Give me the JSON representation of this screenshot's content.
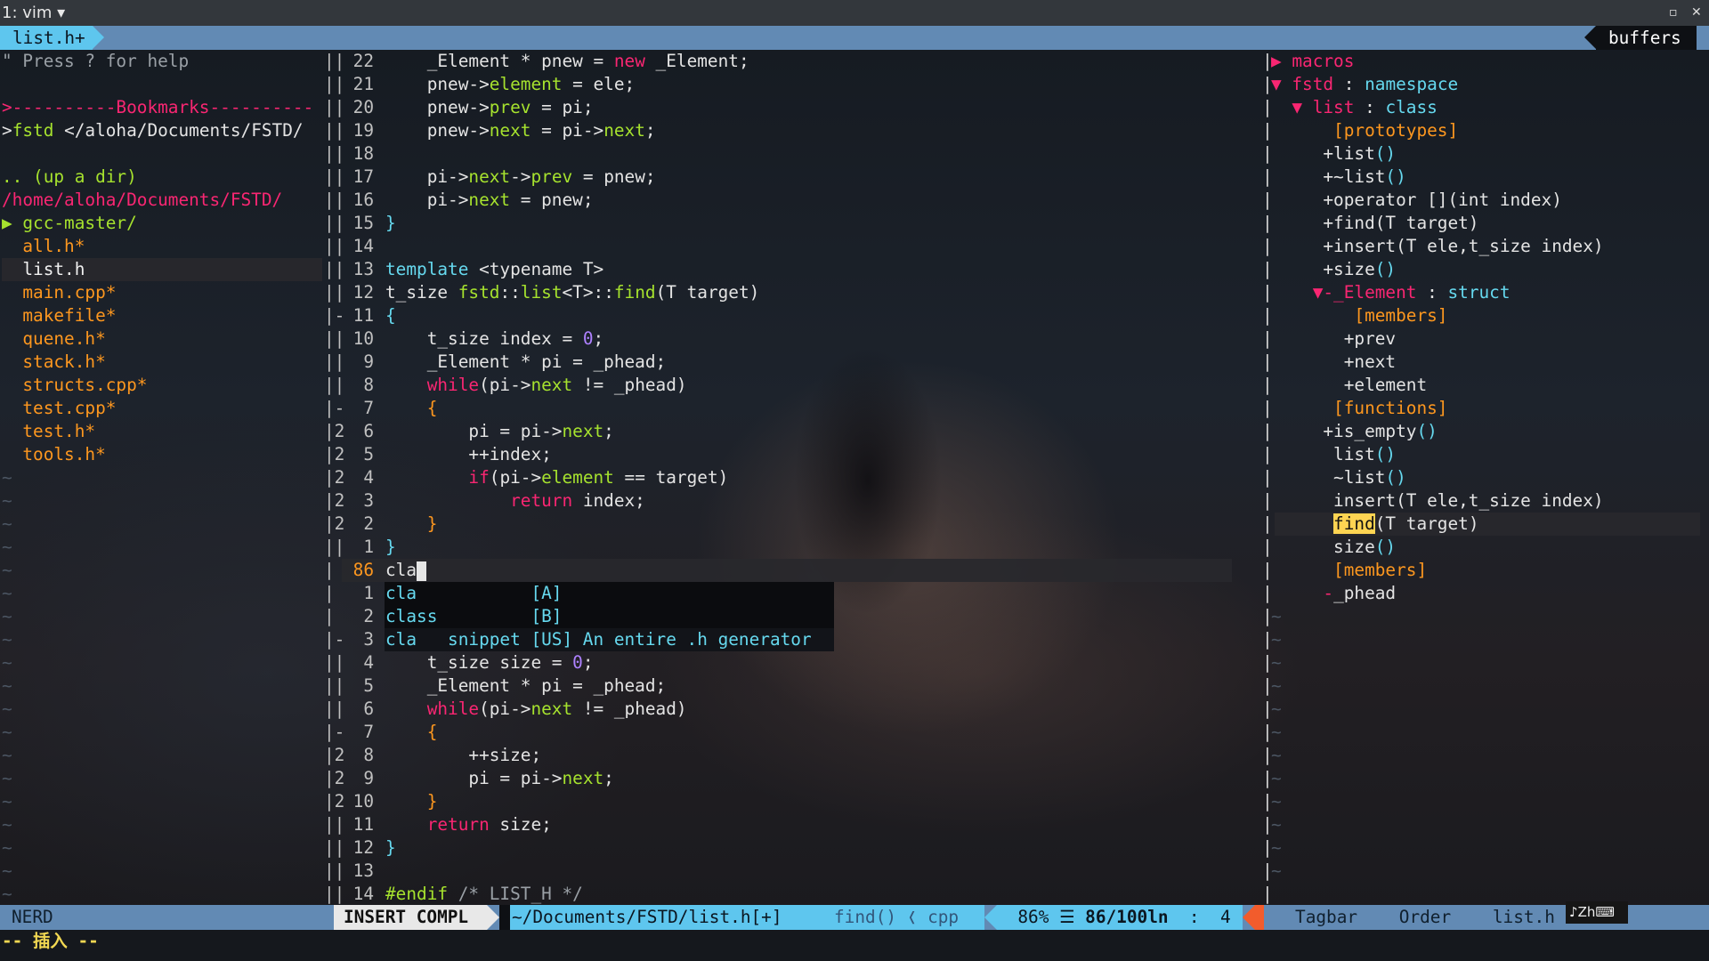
{
  "window": {
    "title": "1: vim",
    "dropdown": "▾",
    "restore": "▫",
    "close": "✕"
  },
  "tabline": {
    "active_tab": "list.h+",
    "buffers_label": "buffers"
  },
  "nerdtree": {
    "help": "\" Press ? for help",
    "bookmarks_header": ">----------Bookmarks----------",
    "bookmark_prefix": ">",
    "bookmark_name": "fstd",
    "bookmark_path": " </aloha/Documents/FSTD/",
    "up_dir": ".. (up a dir)",
    "cwd": "/home/aloha/Documents/FSTD/",
    "folder_arrow": "▶",
    "folder": " gcc-master/",
    "files": [
      "all.h*",
      "list.h",
      "main.cpp*",
      "makefile*",
      "quene.h*",
      "stack.h*",
      "structs.cpp*",
      "test.cpp*",
      "test.h*",
      "tools.h*"
    ],
    "tilde": "~"
  },
  "editor": {
    "gutter_top": [
      "||",
      "||",
      "||",
      "||",
      "||",
      "||",
      "||",
      "||",
      "||",
      "||",
      "||",
      "|-",
      "||",
      "||",
      "||",
      "|-",
      "|2",
      "|2",
      "|2",
      "|2",
      "|2",
      "||"
    ],
    "lnums_top": [
      "22",
      "21",
      "20",
      "19",
      "18",
      "17",
      "16",
      "15",
      "14",
      "13",
      "12",
      "11",
      "10",
      "9",
      "8",
      "7",
      "6",
      "5",
      "4",
      "3",
      "2",
      "1"
    ],
    "code_top": [
      [
        {
          "t": "    _Element * pnew = ",
          "c": ""
        },
        {
          "t": "new",
          "c": "pink"
        },
        {
          "t": " _Element;",
          "c": ""
        }
      ],
      [
        {
          "t": "    pnew->",
          "c": ""
        },
        {
          "t": "element",
          "c": "green"
        },
        {
          "t": " = ele;",
          "c": ""
        }
      ],
      [
        {
          "t": "    pnew->",
          "c": ""
        },
        {
          "t": "prev",
          "c": "green"
        },
        {
          "t": " = pi;",
          "c": ""
        }
      ],
      [
        {
          "t": "    pnew->",
          "c": ""
        },
        {
          "t": "next",
          "c": "green"
        },
        {
          "t": " = pi->",
          "c": ""
        },
        {
          "t": "next",
          "c": "green"
        },
        {
          "t": ";",
          "c": ""
        }
      ],
      [
        {
          "t": "",
          "c": ""
        }
      ],
      [
        {
          "t": "    pi->",
          "c": ""
        },
        {
          "t": "next",
          "c": "green"
        },
        {
          "t": "->",
          "c": ""
        },
        {
          "t": "prev",
          "c": "green"
        },
        {
          "t": " = pnew;",
          "c": ""
        }
      ],
      [
        {
          "t": "    pi->",
          "c": ""
        },
        {
          "t": "next",
          "c": "green"
        },
        {
          "t": " = pnew;",
          "c": ""
        }
      ],
      [
        {
          "t": "}",
          "c": "cyan"
        }
      ],
      [
        {
          "t": "",
          "c": ""
        }
      ],
      [
        {
          "t": "template",
          "c": "cyan"
        },
        {
          "t": " <typename T>",
          "c": ""
        }
      ],
      [
        {
          "t": "t_size ",
          "c": ""
        },
        {
          "t": "fstd",
          "c": "green"
        },
        {
          "t": "::",
          "c": ""
        },
        {
          "t": "list",
          "c": "green"
        },
        {
          "t": "<T>::",
          "c": ""
        },
        {
          "t": "find",
          "c": "green"
        },
        {
          "t": "(T target)",
          "c": ""
        }
      ],
      [
        {
          "t": "{",
          "c": "cyan"
        }
      ],
      [
        {
          "t": "    t_size index = ",
          "c": ""
        },
        {
          "t": "0",
          "c": "purple"
        },
        {
          "t": ";",
          "c": ""
        }
      ],
      [
        {
          "t": "    _Element * pi = _phead;",
          "c": ""
        }
      ],
      [
        {
          "t": "    ",
          "c": ""
        },
        {
          "t": "while",
          "c": "pink"
        },
        {
          "t": "(pi->",
          "c": ""
        },
        {
          "t": "next",
          "c": "green"
        },
        {
          "t": " != _phead)",
          "c": ""
        }
      ],
      [
        {
          "t": "    {",
          "c": "orange"
        }
      ],
      [
        {
          "t": "        pi = pi->",
          "c": ""
        },
        {
          "t": "next",
          "c": "green"
        },
        {
          "t": ";",
          "c": ""
        }
      ],
      [
        {
          "t": "        ++index;",
          "c": ""
        }
      ],
      [
        {
          "t": "        ",
          "c": ""
        },
        {
          "t": "if",
          "c": "pink"
        },
        {
          "t": "(pi->",
          "c": ""
        },
        {
          "t": "element",
          "c": "green"
        },
        {
          "t": " == target)",
          "c": ""
        }
      ],
      [
        {
          "t": "            ",
          "c": ""
        },
        {
          "t": "return",
          "c": "pink"
        },
        {
          "t": " index;",
          "c": ""
        }
      ],
      [
        {
          "t": "    }",
          "c": "orange"
        }
      ],
      [
        {
          "t": "}",
          "c": "cyan"
        }
      ]
    ],
    "current_line": {
      "lnum": "86",
      "text": "cla",
      "gutter": "| "
    },
    "popup": [
      {
        "num": "1",
        "word": "cla",
        "menu": "           [A]"
      },
      {
        "num": "2",
        "word": "class",
        "menu": "         [B]"
      },
      {
        "num": "3",
        "word": "cla",
        "menu": "   snippet [US] An entire .h generator"
      }
    ],
    "gutter_pop": [
      "| ",
      "| ",
      "|-"
    ],
    "gutter_bottom": [
      "||",
      "||",
      "||",
      "|-",
      "|2",
      "|2",
      "|2",
      "||",
      "||",
      "||",
      "||"
    ],
    "lnums_bottom": [
      "4",
      "5",
      "6",
      "7",
      "8",
      "9",
      "10",
      "11",
      "12",
      "13",
      "14"
    ],
    "code_bottom": [
      [
        {
          "t": "    t_size size = ",
          "c": ""
        },
        {
          "t": "0",
          "c": "purple"
        },
        {
          "t": ";",
          "c": ""
        }
      ],
      [
        {
          "t": "    _Element * pi = _phead;",
          "c": ""
        }
      ],
      [
        {
          "t": "    ",
          "c": ""
        },
        {
          "t": "while",
          "c": "pink"
        },
        {
          "t": "(pi->",
          "c": ""
        },
        {
          "t": "next",
          "c": "green"
        },
        {
          "t": " != _phead)",
          "c": ""
        }
      ],
      [
        {
          "t": "    {",
          "c": "orange"
        }
      ],
      [
        {
          "t": "        ++size;",
          "c": ""
        }
      ],
      [
        {
          "t": "        pi = pi->",
          "c": ""
        },
        {
          "t": "next",
          "c": "green"
        },
        {
          "t": ";",
          "c": ""
        }
      ],
      [
        {
          "t": "    }",
          "c": "orange"
        }
      ],
      [
        {
          "t": "    ",
          "c": ""
        },
        {
          "t": "return",
          "c": "pink"
        },
        {
          "t": " size;",
          "c": ""
        }
      ],
      [
        {
          "t": "}",
          "c": "cyan"
        }
      ],
      [
        {
          "t": "",
          "c": ""
        }
      ],
      [
        {
          "t": "#endif",
          "c": "green"
        },
        {
          "t": " /* LIST_H */",
          "c": "gray"
        }
      ]
    ]
  },
  "tagbar": {
    "lines": [
      [
        {
          "t": "▶ ",
          "c": "pink"
        },
        {
          "t": "macros",
          "c": "pink"
        }
      ],
      [
        {
          "t": "▼ ",
          "c": "pink"
        },
        {
          "t": "fstd",
          "c": "pink"
        },
        {
          "t": " : ",
          "c": ""
        },
        {
          "t": "namespace",
          "c": "cyan"
        }
      ],
      [
        {
          "t": "  ▼ ",
          "c": "pink"
        },
        {
          "t": "list",
          "c": "pink"
        },
        {
          "t": " : ",
          "c": ""
        },
        {
          "t": "class",
          "c": "cyan"
        }
      ],
      [
        {
          "t": "      [prototypes]",
          "c": "orange"
        }
      ],
      [
        {
          "t": "     +list",
          "c": ""
        },
        {
          "t": "()",
          "c": "cyan"
        }
      ],
      [
        {
          "t": "     +~list",
          "c": ""
        },
        {
          "t": "()",
          "c": "cyan"
        }
      ],
      [
        {
          "t": "     +operator [](int index)",
          "c": ""
        }
      ],
      [
        {
          "t": "     +find(T target)",
          "c": ""
        }
      ],
      [
        {
          "t": "     +insert(T ele,t_size index)",
          "c": ""
        }
      ],
      [
        {
          "t": "     +size",
          "c": ""
        },
        {
          "t": "()",
          "c": "cyan"
        }
      ],
      [
        {
          "t": "    ▼",
          "c": "pink"
        },
        {
          "t": "-_Element",
          "c": "pink"
        },
        {
          "t": " : ",
          "c": ""
        },
        {
          "t": "struct",
          "c": "cyan"
        }
      ],
      [
        {
          "t": "        [members]",
          "c": "orange"
        }
      ],
      [
        {
          "t": "       +prev",
          "c": ""
        }
      ],
      [
        {
          "t": "       +next",
          "c": ""
        }
      ],
      [
        {
          "t": "       +element",
          "c": ""
        }
      ],
      [
        {
          "t": "      [functions]",
          "c": "orange"
        }
      ],
      [
        {
          "t": "     +is_empty",
          "c": ""
        },
        {
          "t": "()",
          "c": "cyan"
        }
      ],
      [
        {
          "t": "      list",
          "c": ""
        },
        {
          "t": "()",
          "c": "cyan"
        }
      ],
      [
        {
          "t": "      ~list",
          "c": ""
        },
        {
          "t": "()",
          "c": "cyan"
        }
      ],
      [
        {
          "t": "      insert(T ele,t_size index)",
          "c": ""
        }
      ],
      [
        {
          "t": "      ",
          "c": ""
        },
        {
          "t": "find",
          "c": "hl"
        },
        {
          "t": "(T target)",
          "c": ""
        }
      ],
      [
        {
          "t": "      size",
          "c": ""
        },
        {
          "t": "()",
          "c": "cyan"
        }
      ],
      [
        {
          "t": "      [members]",
          "c": "orange"
        }
      ],
      [
        {
          "t": "     ",
          "c": ""
        },
        {
          "t": "-",
          "c": "pink"
        },
        {
          "t": "_phead",
          "c": ""
        }
      ]
    ],
    "separator": "|"
  },
  "statusline": {
    "nerd": "NERD",
    "mode": "INSERT COMPL",
    "file": "~/Documents/FSTD/list.h[+]",
    "func": "find()",
    "ft": "cpp",
    "percent": "86%",
    "lines_icon": "☰",
    "position": "86/100ln",
    "colon": ":",
    "col": "4",
    "tagbar": "Tagbar",
    "order": "Order",
    "tagfile": "list.h",
    "ime": "♪Zh⌨"
  },
  "cmdline": {
    "text": "-- 插入 --"
  },
  "colors": {
    "accent": "#5ec6ee",
    "status_bg": "#628ab4",
    "keyword": "#f92672",
    "ident": "#a6e22e",
    "type": "#66d9ef",
    "section": "#fd971f",
    "number": "#ae81ff",
    "highlight": "#fed452"
  }
}
